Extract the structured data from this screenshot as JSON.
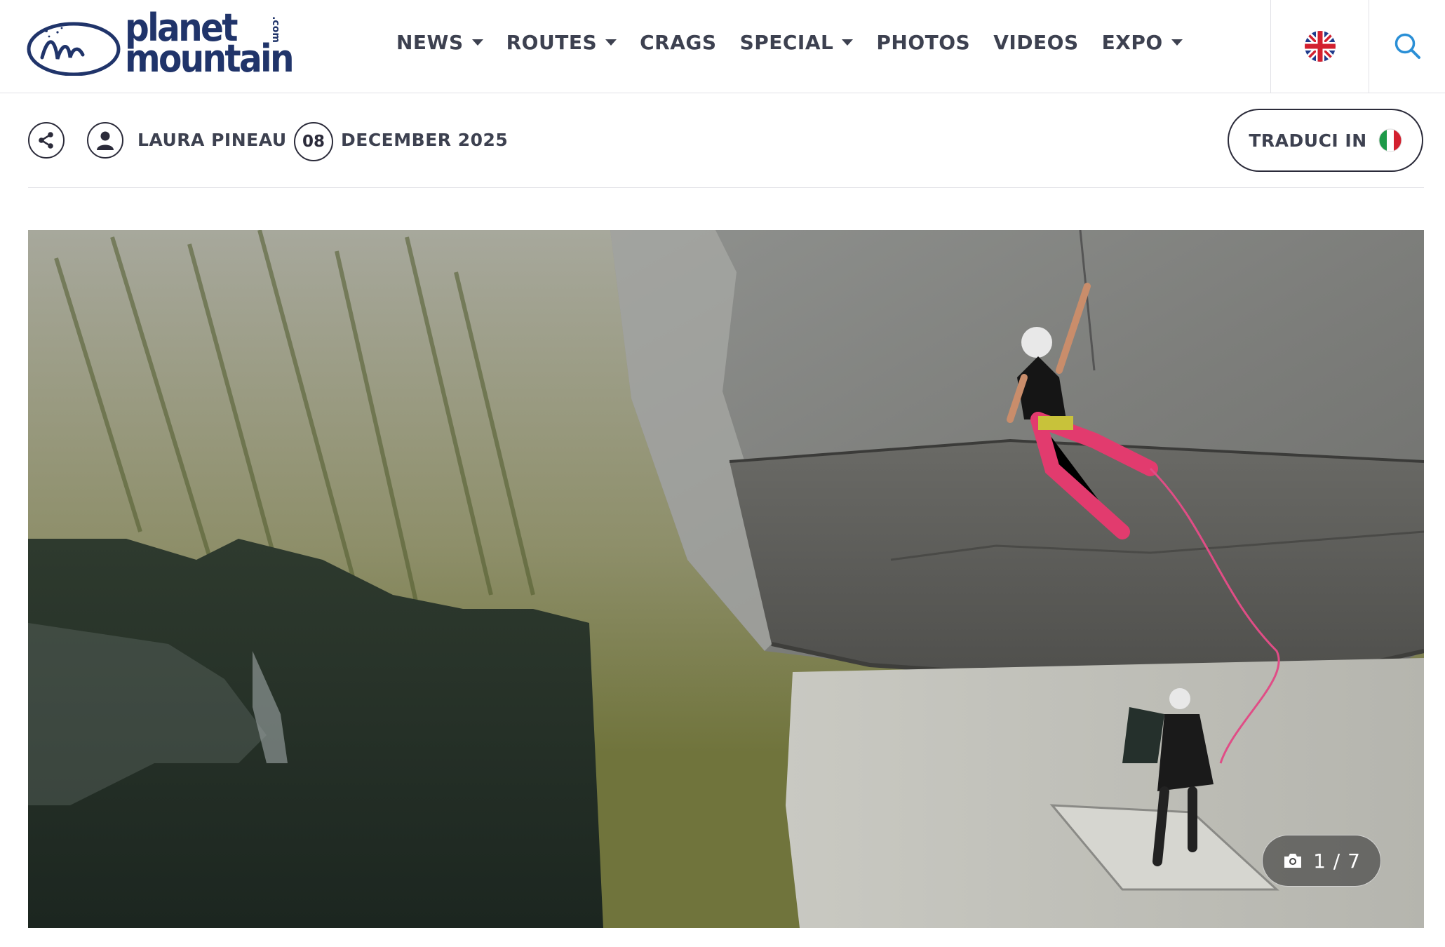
{
  "brand": {
    "line1": "planet",
    "line2": "mountain",
    "suffix": ".com"
  },
  "nav": {
    "items": [
      {
        "label": "NEWS",
        "dropdown": true
      },
      {
        "label": "ROUTES",
        "dropdown": true
      },
      {
        "label": "CRAGS",
        "dropdown": false
      },
      {
        "label": "SPECIAL",
        "dropdown": true
      },
      {
        "label": "PHOTOS",
        "dropdown": false
      },
      {
        "label": "VIDEOS",
        "dropdown": false
      },
      {
        "label": "EXPO",
        "dropdown": true
      }
    ],
    "language_icon": "uk-flag-icon",
    "search_icon": "search-icon"
  },
  "article_meta": {
    "share_icon": "share-icon",
    "author_icon": "user-icon",
    "author": "LAURA PINEAU",
    "day": "08",
    "month_year": "DECEMBER 2025",
    "translate_label": "TRADUCI IN",
    "translate_flag": "italy-flag-icon"
  },
  "gallery": {
    "current": "1 / 7",
    "camera_icon": "camera-icon"
  },
  "colors": {
    "brand_blue": "#20346a",
    "text_dark": "#3d4150",
    "accent_blue": "#2a8fd6",
    "divider": "#e1e1e6"
  }
}
